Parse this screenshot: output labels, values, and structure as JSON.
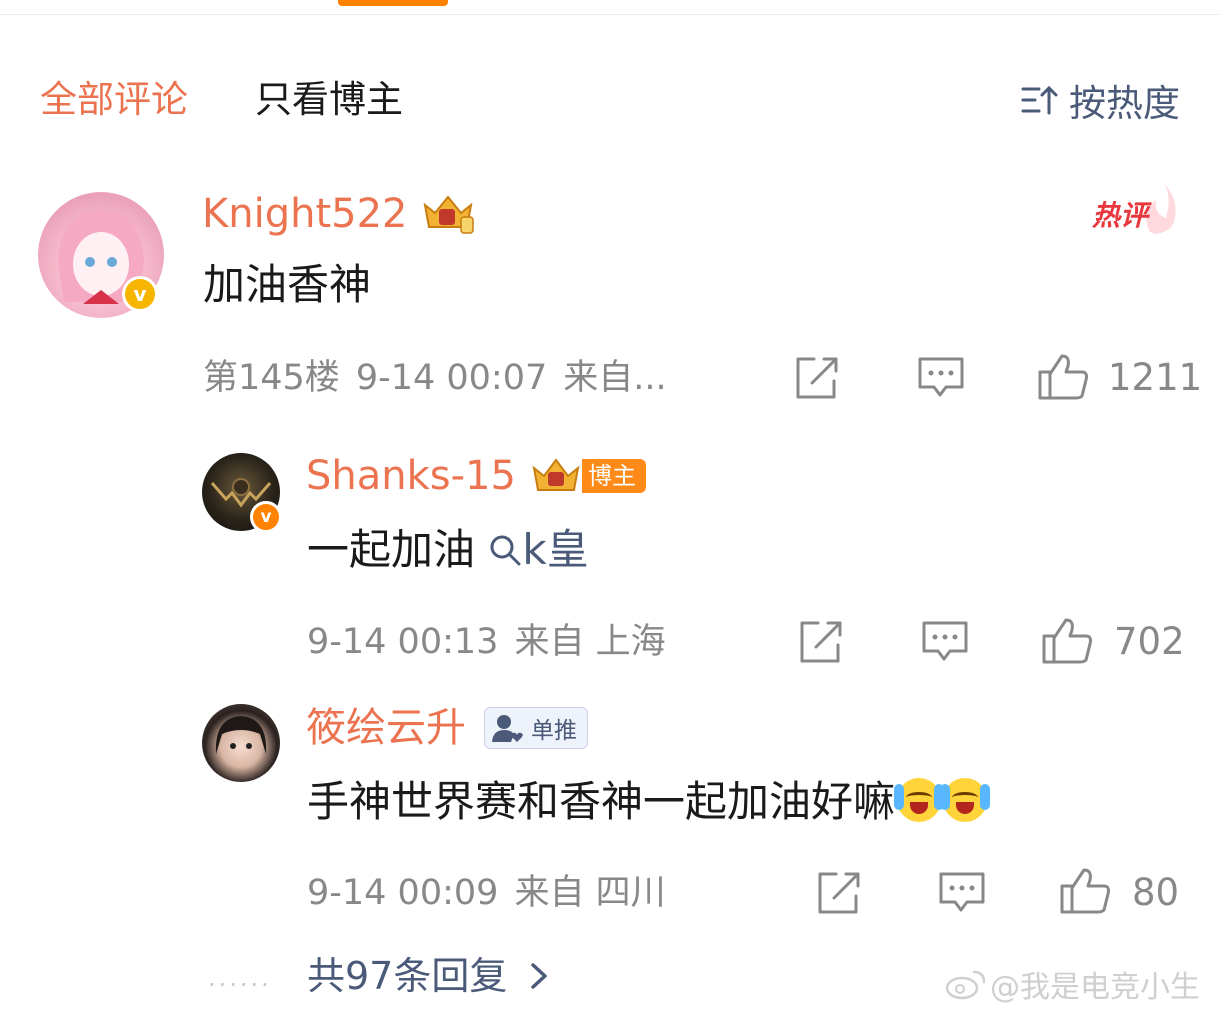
{
  "tabs": {
    "all": "全部评论",
    "author_only": "只看博主"
  },
  "sort": {
    "label": "按热度",
    "icon": "sort-icon"
  },
  "comment": {
    "username": "Knight522",
    "text": "加油香神",
    "hot_badge": "热评",
    "floor": "第145楼",
    "time": "9-14 00:07",
    "location": "来自...",
    "likes": "1211",
    "verified": "v"
  },
  "replies": [
    {
      "username": "Shanks-15",
      "badge": "博主",
      "text": "一起加油",
      "topic": "k皇",
      "time": "9-14 00:13",
      "location": "来自 上海",
      "likes": "702",
      "verified": "v"
    },
    {
      "username": "筱绘云升",
      "badge": "单推",
      "text": "手神世界赛和香神一起加油好嘛",
      "time": "9-14 00:09",
      "location": "来自 四川",
      "likes": "80"
    }
  ],
  "more_replies": "共97条回复",
  "more_dots": "......",
  "watermark": "@我是电竞小生",
  "colors": {
    "accent": "#eb7350",
    "link": "#4a5a78",
    "meta": "#888888",
    "brand_orange": "#ff8200"
  }
}
